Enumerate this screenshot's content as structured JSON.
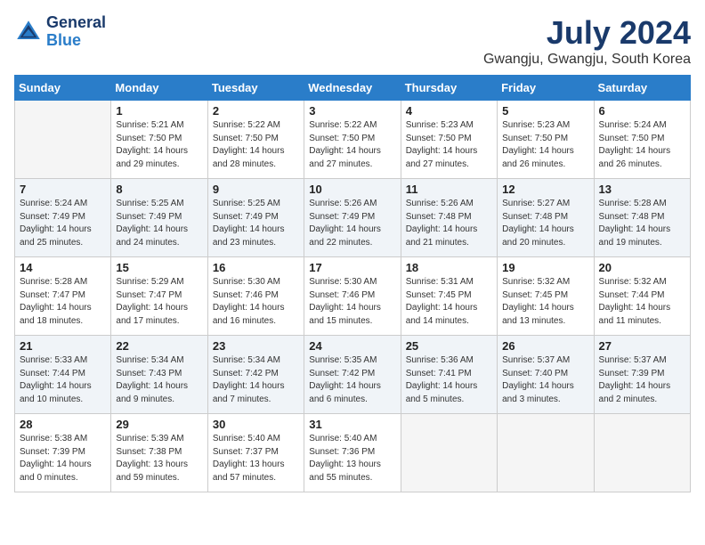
{
  "logo": {
    "line1": "General",
    "line2": "Blue"
  },
  "title": "July 2024",
  "location": "Gwangju, Gwangju, South Korea",
  "days_header": [
    "Sunday",
    "Monday",
    "Tuesday",
    "Wednesday",
    "Thursday",
    "Friday",
    "Saturday"
  ],
  "weeks": [
    [
      {
        "num": "",
        "detail": ""
      },
      {
        "num": "1",
        "detail": "Sunrise: 5:21 AM\nSunset: 7:50 PM\nDaylight: 14 hours\nand 29 minutes."
      },
      {
        "num": "2",
        "detail": "Sunrise: 5:22 AM\nSunset: 7:50 PM\nDaylight: 14 hours\nand 28 minutes."
      },
      {
        "num": "3",
        "detail": "Sunrise: 5:22 AM\nSunset: 7:50 PM\nDaylight: 14 hours\nand 27 minutes."
      },
      {
        "num": "4",
        "detail": "Sunrise: 5:23 AM\nSunset: 7:50 PM\nDaylight: 14 hours\nand 27 minutes."
      },
      {
        "num": "5",
        "detail": "Sunrise: 5:23 AM\nSunset: 7:50 PM\nDaylight: 14 hours\nand 26 minutes."
      },
      {
        "num": "6",
        "detail": "Sunrise: 5:24 AM\nSunset: 7:50 PM\nDaylight: 14 hours\nand 26 minutes."
      }
    ],
    [
      {
        "num": "7",
        "detail": "Sunrise: 5:24 AM\nSunset: 7:49 PM\nDaylight: 14 hours\nand 25 minutes."
      },
      {
        "num": "8",
        "detail": "Sunrise: 5:25 AM\nSunset: 7:49 PM\nDaylight: 14 hours\nand 24 minutes."
      },
      {
        "num": "9",
        "detail": "Sunrise: 5:25 AM\nSunset: 7:49 PM\nDaylight: 14 hours\nand 23 minutes."
      },
      {
        "num": "10",
        "detail": "Sunrise: 5:26 AM\nSunset: 7:49 PM\nDaylight: 14 hours\nand 22 minutes."
      },
      {
        "num": "11",
        "detail": "Sunrise: 5:26 AM\nSunset: 7:48 PM\nDaylight: 14 hours\nand 21 minutes."
      },
      {
        "num": "12",
        "detail": "Sunrise: 5:27 AM\nSunset: 7:48 PM\nDaylight: 14 hours\nand 20 minutes."
      },
      {
        "num": "13",
        "detail": "Sunrise: 5:28 AM\nSunset: 7:48 PM\nDaylight: 14 hours\nand 19 minutes."
      }
    ],
    [
      {
        "num": "14",
        "detail": "Sunrise: 5:28 AM\nSunset: 7:47 PM\nDaylight: 14 hours\nand 18 minutes."
      },
      {
        "num": "15",
        "detail": "Sunrise: 5:29 AM\nSunset: 7:47 PM\nDaylight: 14 hours\nand 17 minutes."
      },
      {
        "num": "16",
        "detail": "Sunrise: 5:30 AM\nSunset: 7:46 PM\nDaylight: 14 hours\nand 16 minutes."
      },
      {
        "num": "17",
        "detail": "Sunrise: 5:30 AM\nSunset: 7:46 PM\nDaylight: 14 hours\nand 15 minutes."
      },
      {
        "num": "18",
        "detail": "Sunrise: 5:31 AM\nSunset: 7:45 PM\nDaylight: 14 hours\nand 14 minutes."
      },
      {
        "num": "19",
        "detail": "Sunrise: 5:32 AM\nSunset: 7:45 PM\nDaylight: 14 hours\nand 13 minutes."
      },
      {
        "num": "20",
        "detail": "Sunrise: 5:32 AM\nSunset: 7:44 PM\nDaylight: 14 hours\nand 11 minutes."
      }
    ],
    [
      {
        "num": "21",
        "detail": "Sunrise: 5:33 AM\nSunset: 7:44 PM\nDaylight: 14 hours\nand 10 minutes."
      },
      {
        "num": "22",
        "detail": "Sunrise: 5:34 AM\nSunset: 7:43 PM\nDaylight: 14 hours\nand 9 minutes."
      },
      {
        "num": "23",
        "detail": "Sunrise: 5:34 AM\nSunset: 7:42 PM\nDaylight: 14 hours\nand 7 minutes."
      },
      {
        "num": "24",
        "detail": "Sunrise: 5:35 AM\nSunset: 7:42 PM\nDaylight: 14 hours\nand 6 minutes."
      },
      {
        "num": "25",
        "detail": "Sunrise: 5:36 AM\nSunset: 7:41 PM\nDaylight: 14 hours\nand 5 minutes."
      },
      {
        "num": "26",
        "detail": "Sunrise: 5:37 AM\nSunset: 7:40 PM\nDaylight: 14 hours\nand 3 minutes."
      },
      {
        "num": "27",
        "detail": "Sunrise: 5:37 AM\nSunset: 7:39 PM\nDaylight: 14 hours\nand 2 minutes."
      }
    ],
    [
      {
        "num": "28",
        "detail": "Sunrise: 5:38 AM\nSunset: 7:39 PM\nDaylight: 14 hours\nand 0 minutes."
      },
      {
        "num": "29",
        "detail": "Sunrise: 5:39 AM\nSunset: 7:38 PM\nDaylight: 13 hours\nand 59 minutes."
      },
      {
        "num": "30",
        "detail": "Sunrise: 5:40 AM\nSunset: 7:37 PM\nDaylight: 13 hours\nand 57 minutes."
      },
      {
        "num": "31",
        "detail": "Sunrise: 5:40 AM\nSunset: 7:36 PM\nDaylight: 13 hours\nand 55 minutes."
      },
      {
        "num": "",
        "detail": ""
      },
      {
        "num": "",
        "detail": ""
      },
      {
        "num": "",
        "detail": ""
      }
    ]
  ]
}
